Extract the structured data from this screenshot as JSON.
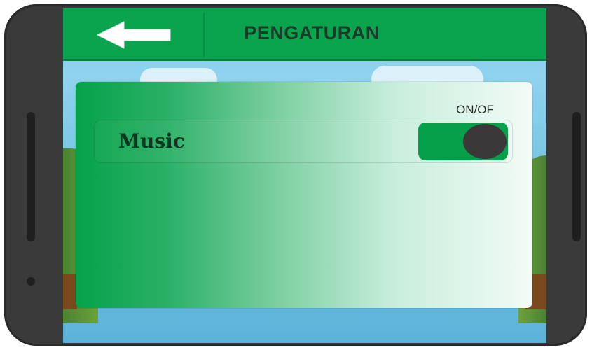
{
  "header": {
    "title": "PENGATURAN",
    "back_icon": "arrow-left-icon"
  },
  "settings": {
    "column_label": "ON/OF",
    "items": [
      {
        "label": "Music",
        "toggle_state": "on"
      }
    ]
  },
  "colors": {
    "accent_green": "#0aa44e",
    "toggle_knob": "#3a3838",
    "phone_frame": "#3a3a3a"
  }
}
